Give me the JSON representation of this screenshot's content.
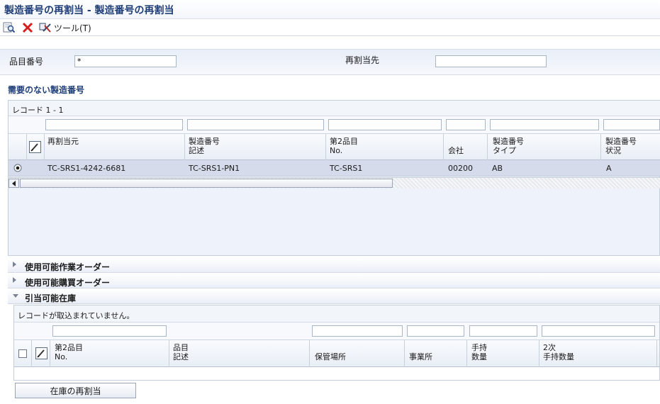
{
  "window": {
    "title": "製造番号の再割当 - 製造番号の再割当"
  },
  "toolbar": {
    "find_icon": "find-magnifier-icon",
    "close_icon": "red-x-icon",
    "tools_icon": "tools-icon",
    "tools_label": "ツール(T)"
  },
  "form": {
    "item_number_label": "品目番号",
    "item_number_value": "*",
    "reassign_to_label": "再割当先",
    "reassign_to_value": ""
  },
  "lots_section": {
    "title": "需要のない製造番号",
    "records": "レコード 1 - 1",
    "columns": [
      {
        "line1": "",
        "line2": "再割当元"
      },
      {
        "line1": "製造番号",
        "line2": "記述"
      },
      {
        "line1": "第2品目",
        "line2": "No."
      },
      {
        "line1": "",
        "line2": "会社"
      },
      {
        "line1": "製造番号",
        "line2": "タイプ"
      },
      {
        "line1": "製造番号",
        "line2": "状況"
      }
    ],
    "rows": [
      {
        "selected": true,
        "cells": [
          "TC-SRS1-4242-6681",
          "TC-SRS1-PN1",
          "TC-SRS1",
          "00200",
          "AB",
          "A"
        ]
      }
    ]
  },
  "collapsible_sections": [
    {
      "label": "使用可能作業オーダー",
      "expanded": false
    },
    {
      "label": "使用可能購買オーダー",
      "expanded": false
    },
    {
      "label": "引当可能在庫",
      "expanded": true
    }
  ],
  "inventory_grid": {
    "records": "レコードが取込まれていません。",
    "columns": [
      {
        "line1": "第2品目",
        "line2": "No."
      },
      {
        "line1": "品目",
        "line2": "記述"
      },
      {
        "line1": "",
        "line2": "保管場所"
      },
      {
        "line1": "",
        "line2": "事業所"
      },
      {
        "line1": "手持",
        "line2": "数量"
      },
      {
        "line1": "2次",
        "line2": "手持数量"
      }
    ]
  },
  "buttons": {
    "reassign_inventory": "在庫の再割当"
  },
  "colors": {
    "title": "#1f3e78",
    "accent_red": "#d42020",
    "selected_row": "#d5dbeb"
  }
}
